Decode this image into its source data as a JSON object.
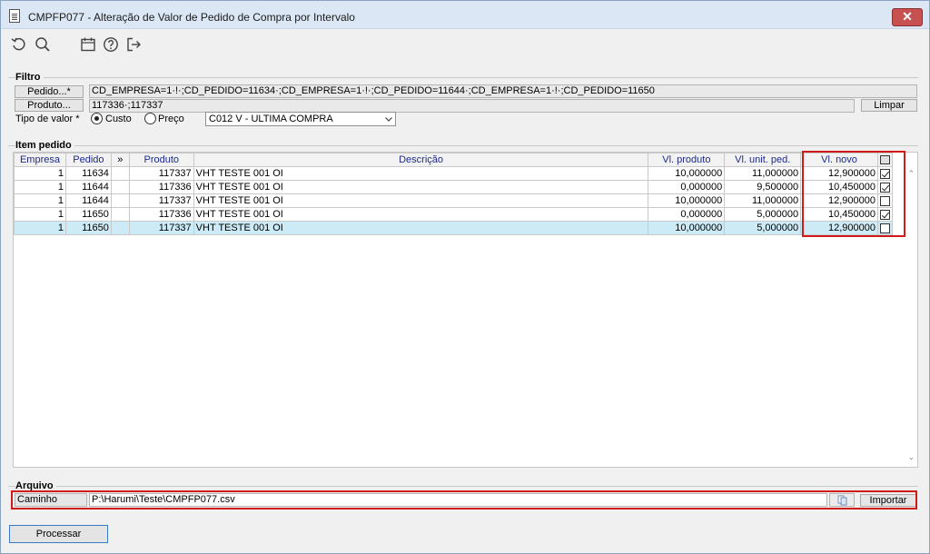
{
  "window": {
    "title": "CMPFP077 - Alteração de Valor de Pedido de Compra por Intervalo",
    "close_label": "✕"
  },
  "toolbar": {
    "icons": [
      "undo-icon",
      "search-icon",
      "calendar-icon",
      "help-icon",
      "exit-icon"
    ]
  },
  "filtro": {
    "legend": "Filtro",
    "pedido_button": "Pedido...*",
    "pedido_value": "CD_EMPRESA=1·!·;CD_PEDIDO=11634·;CD_EMPRESA=1·!·;CD_PEDIDO=11644·;CD_EMPRESA=1·!·;CD_PEDIDO=11650",
    "produto_button": "Produto...",
    "produto_value": "117336·;117337",
    "limpar_button": "Limpar",
    "tipo_valor_label": "Tipo de valor *",
    "radio_custo": "Custo",
    "radio_preco": "Preço",
    "selected_radio": "Custo",
    "compra_select": "C012 V - ULTIMA COMPRA"
  },
  "item_pedido": {
    "legend": "Item pedido",
    "columns": [
      "Empresa",
      "Pedido",
      "»",
      "Produto",
      "Descrição",
      "Vl. produto",
      "Vl. unit. ped.",
      "Vl. novo",
      ""
    ],
    "rows": [
      {
        "empresa": "1",
        "pedido": "11634",
        "produto": "117337",
        "descricao": "VHT TESTE 001 OI",
        "vl_produto": "10,000000",
        "vl_unit_ped": "11,000000",
        "vl_novo": "12,900000",
        "checked": true,
        "selected": false
      },
      {
        "empresa": "1",
        "pedido": "11644",
        "produto": "117336",
        "descricao": "VHT TESTE 001 OI",
        "vl_produto": "0,000000",
        "vl_unit_ped": "9,500000",
        "vl_novo": "10,450000",
        "checked": true,
        "selected": false
      },
      {
        "empresa": "1",
        "pedido": "11644",
        "produto": "117337",
        "descricao": "VHT TESTE 001 OI",
        "vl_produto": "10,000000",
        "vl_unit_ped": "11,000000",
        "vl_novo": "12,900000",
        "checked": false,
        "selected": false
      },
      {
        "empresa": "1",
        "pedido": "11650",
        "produto": "117336",
        "descricao": "VHT TESTE 001 OI",
        "vl_produto": "0,000000",
        "vl_unit_ped": "5,000000",
        "vl_novo": "10,450000",
        "checked": true,
        "selected": false
      },
      {
        "empresa": "1",
        "pedido": "11650",
        "produto": "117337",
        "descricao": "VHT TESTE 001 OI",
        "vl_produto": "10,000000",
        "vl_unit_ped": "5,000000",
        "vl_novo": "12,900000",
        "checked": false,
        "selected": true
      }
    ]
  },
  "arquivo": {
    "legend": "Arquivo",
    "caminho_label": "Caminho",
    "caminho_value": "P:\\Harumi\\Teste\\CMPFP077.csv",
    "importar_button": "Importar"
  },
  "processar_button": "Processar",
  "colors": {
    "highlight": "#d11a1a",
    "selected_row": "#cdebf7",
    "header_text": "#1d2a8c"
  }
}
